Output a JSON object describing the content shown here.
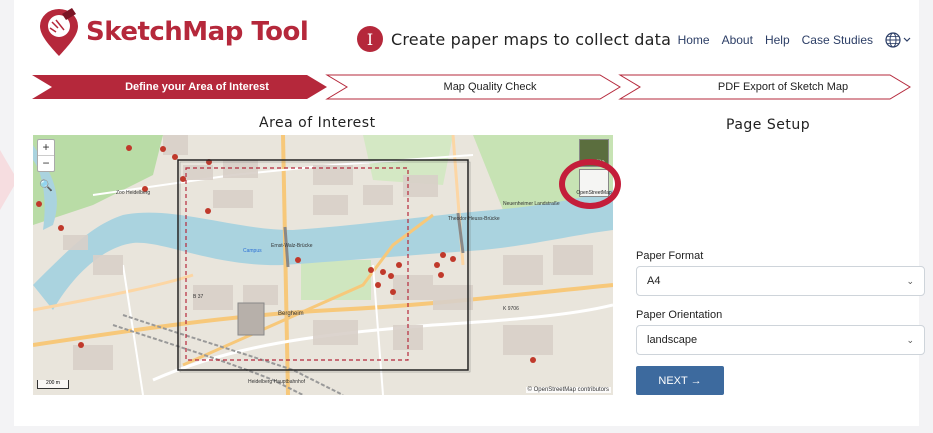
{
  "header": {
    "brand": "SketchMap Tool",
    "step_badge": "I",
    "tagline": "Create paper maps to collect data",
    "nav": [
      "Home",
      "About",
      "Help",
      "Case Studies"
    ],
    "globe_icon": "globe-icon"
  },
  "stepper": {
    "steps": [
      {
        "label": "Define your Area of Interest",
        "active": true
      },
      {
        "label": "Map Quality Check",
        "active": false
      },
      {
        "label": "PDF Export of Sketch Map",
        "active": false
      }
    ],
    "active_color": "#b5283b"
  },
  "map_section": {
    "title": "Area of Interest",
    "zoom_in": "+",
    "zoom_out": "−",
    "layer_satellite": "Satellite",
    "layer_osm": "OpenStreetMap",
    "scale": "200 m",
    "attribution": "© OpenStreetMap contributors",
    "map_labels": {
      "zoo": "Zoo Heidelberg",
      "bridge": "Ernst-Walz-Brücke",
      "bergheim": "Bergheim",
      "b37": "B 37",
      "theodor": "Theodor-Heuss-Brücke",
      "neuenheim": "Neuenheimer Landstraße",
      "campus": "Campus",
      "station": "Heidelberg Hauptbahnhof",
      "k9706": "K 9706"
    }
  },
  "page_setup": {
    "title": "Page Setup",
    "paper_format_label": "Paper Format",
    "paper_format_value": "A4",
    "paper_orientation_label": "Paper Orientation",
    "paper_orientation_value": "landscape",
    "next_button": "NEXT →"
  },
  "colors": {
    "brand": "#b5283b",
    "button": "#3d6a9e",
    "highlight_circle": "#c41e3a"
  }
}
